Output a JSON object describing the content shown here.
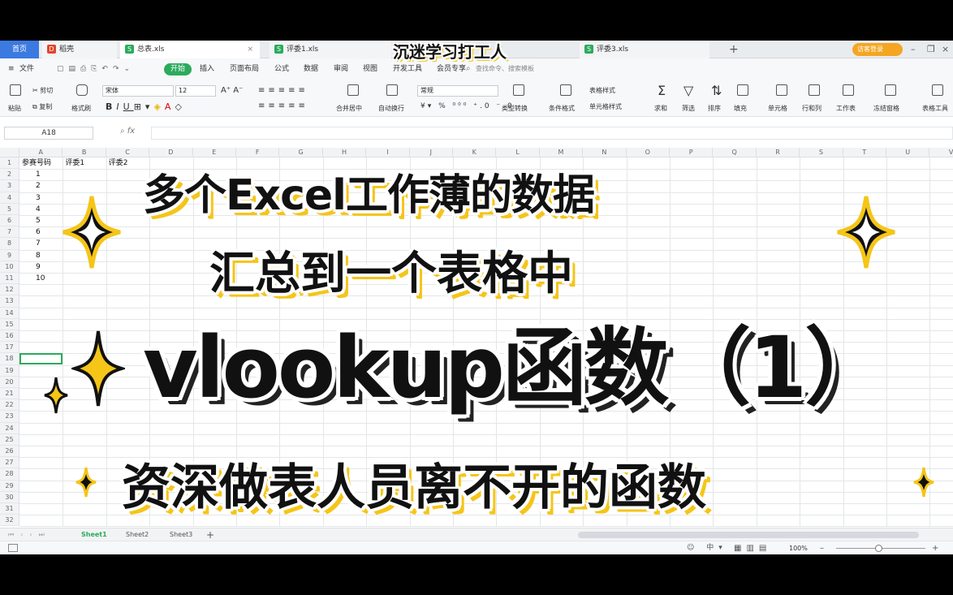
{
  "tabs": {
    "home": "首页",
    "doc": "稻壳",
    "active": "总表.xls",
    "p1": "评委1.xls",
    "p3": "评委3.xls",
    "login": "访客登录"
  },
  "banner": "沉迷学习打工人",
  "menu": {
    "file": "文件",
    "start": "开始",
    "items": [
      "插入",
      "页面布局",
      "公式",
      "数据",
      "审阅",
      "视图",
      "开发工具",
      "会员专享"
    ],
    "search": "查找命令、搜索模板"
  },
  "ribbon": {
    "paste": "粘贴",
    "cut": "剪切",
    "copy": "复制",
    "format_painter": "格式刷",
    "font": "宋体",
    "size": "12",
    "merge": "合并居中",
    "wrap": "自动换行",
    "numfmt": "常规",
    "convert": "类型转换",
    "cond": "条件格式",
    "table_style": "表格样式",
    "cell_style": "单元格样式",
    "sum": "求和",
    "filter": "筛选",
    "sort": "排序",
    "fill": "填充",
    "cell": "单元格",
    "rowcol": "行和列",
    "sheet": "工作表",
    "freeze": "冻结窗格",
    "tabletools": "表格工具"
  },
  "formula": {
    "namebox": "A18",
    "fx": "fx"
  },
  "grid": {
    "columns": [
      "A",
      "B",
      "C",
      "D",
      "E",
      "F",
      "G",
      "H",
      "I",
      "J",
      "K",
      "L",
      "M",
      "N",
      "O",
      "P",
      "Q",
      "R",
      "S",
      "T",
      "U",
      "V"
    ],
    "header_row": [
      "参赛号码",
      "评委1",
      "评委2"
    ],
    "ids": [
      "1",
      "2",
      "3",
      "4",
      "5",
      "6",
      "7",
      "8",
      "9",
      "10"
    ]
  },
  "sheets": [
    "Sheet1",
    "Sheet2",
    "Sheet3"
  ],
  "status": {
    "zoom": "100%"
  },
  "overlay": {
    "line1": "多个Excel工作薄的数据",
    "line2": "汇总到一个表格中",
    "line3": "vlookup函数（1）",
    "line4": "资深做表人员离不开的函数"
  }
}
